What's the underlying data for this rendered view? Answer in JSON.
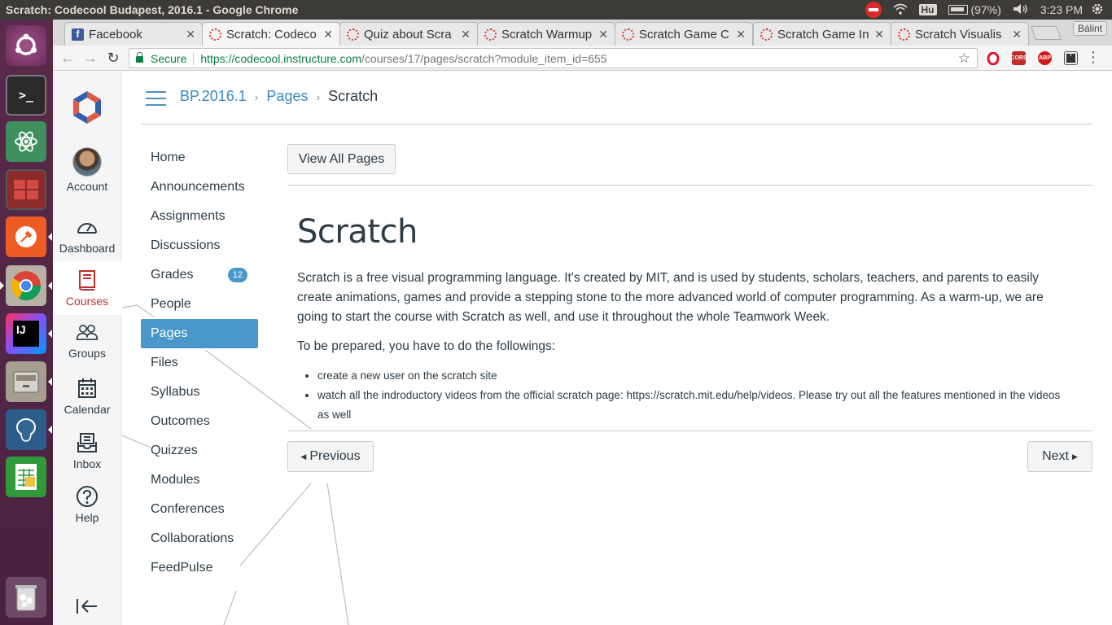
{
  "os": {
    "window_title": "Scratch: Codecool Budapest, 2016.1 - Google Chrome",
    "keyboard_layout": "Hu",
    "battery": "(97%)",
    "clock": "3:23 PM",
    "launcher": [
      {
        "name": "ubuntu-dash-icon",
        "color": "#7d3f6e"
      },
      {
        "name": "terminal-icon",
        "color": "#2b2b2b"
      },
      {
        "name": "atom-icon",
        "color": "#3f8f5f"
      },
      {
        "name": "workspace-switcher-icon",
        "color": "#a23030"
      },
      {
        "name": "postman-icon",
        "color": "#ef5b25"
      },
      {
        "name": "chrome-icon",
        "color": "#cc3333"
      },
      {
        "name": "intellij-icon",
        "color": "#2a2a6a"
      },
      {
        "name": "files-icon",
        "color": "#8a8378"
      },
      {
        "name": "pgadmin-icon",
        "color": "#336791"
      },
      {
        "name": "spreadsheet-icon",
        "color": "#2f9a3a"
      },
      {
        "name": "trash-icon",
        "color": "#9a9a9a"
      }
    ]
  },
  "browser": {
    "tabs": [
      {
        "title": "Facebook",
        "icon": "facebook-icon",
        "active": false
      },
      {
        "title": "Scratch: Codeco",
        "icon": "canvas-icon",
        "active": true
      },
      {
        "title": "Quiz about Scra",
        "icon": "canvas-icon",
        "active": false
      },
      {
        "title": "Scratch Warmup",
        "icon": "canvas-icon",
        "active": false
      },
      {
        "title": "Scratch Game C",
        "icon": "canvas-icon",
        "active": false
      },
      {
        "title": "Scratch Game In",
        "icon": "canvas-icon",
        "active": false
      },
      {
        "title": "Scratch Visualis",
        "icon": "canvas-icon",
        "active": false
      }
    ],
    "profile_name": "Bálint",
    "security_label": "Secure",
    "url_scheme_host": "https://codecool.instructure.com",
    "url_path": "/courses/17/pages/scratch?module_item_id=655"
  },
  "global_nav": {
    "items": [
      {
        "label": "Account",
        "icon": "avatar"
      },
      {
        "label": "Dashboard",
        "icon": "dashboard-icon"
      },
      {
        "label": "Courses",
        "icon": "courses-icon",
        "active": true
      },
      {
        "label": "Groups",
        "icon": "groups-icon"
      },
      {
        "label": "Calendar",
        "icon": "calendar-icon"
      },
      {
        "label": "Inbox",
        "icon": "inbox-icon"
      },
      {
        "label": "Help",
        "icon": "help-icon"
      }
    ],
    "accent": "#c22c2c"
  },
  "breadcrumb": {
    "course": "BP.2016.1",
    "section": "Pages",
    "current": "Scratch"
  },
  "course_nav": {
    "items": [
      {
        "label": "Home"
      },
      {
        "label": "Announcements"
      },
      {
        "label": "Assignments"
      },
      {
        "label": "Discussions"
      },
      {
        "label": "Grades",
        "badge": "12"
      },
      {
        "label": "People"
      },
      {
        "label": "Pages",
        "active": true
      },
      {
        "label": "Files"
      },
      {
        "label": "Syllabus"
      },
      {
        "label": "Outcomes"
      },
      {
        "label": "Quizzes"
      },
      {
        "label": "Modules"
      },
      {
        "label": "Conferences"
      },
      {
        "label": "Collaborations"
      },
      {
        "label": "FeedPulse"
      }
    ],
    "accent": "#4a98c9"
  },
  "page": {
    "view_all_label": "View All Pages",
    "title": "Scratch",
    "paragraph_1": "Scratch is a free visual programming language. It's created by MIT, and is used by students, scholars, teachers, and parents to easily create animations, games and provide a stepping stone to the more advanced world of computer programming. As a warm-up, we are going to start the course with Scratch as well, and use it throughout the whole Teamwork Week.",
    "paragraph_2": "To be prepared, you have to do the followings:",
    "bullets": [
      "create a new user on the scratch site",
      "watch all the indroductory videos from the official scratch page: https://scratch.mit.edu/help/videos. Please try out all the features mentioned in the videos as well"
    ],
    "previous_label": "Previous",
    "next_label": "Next"
  }
}
